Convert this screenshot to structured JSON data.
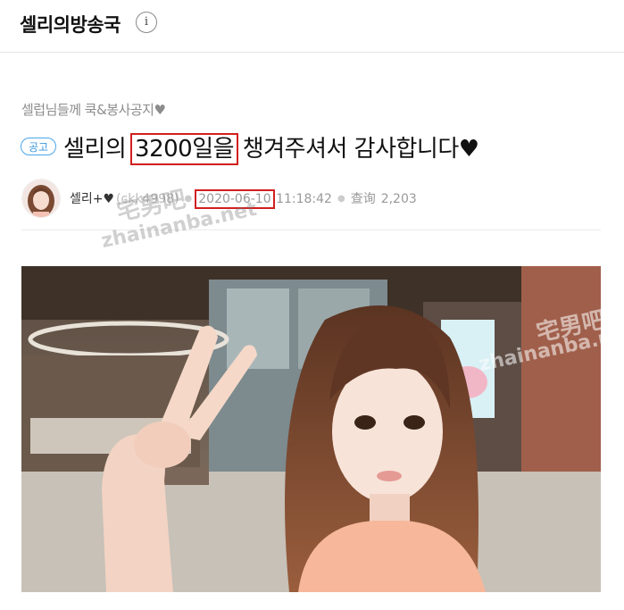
{
  "header": {
    "site_title": "셀리의방송국",
    "info_icon": "i"
  },
  "post": {
    "category": "셀럽님들께 쿡&봉사공지♥",
    "badge": "공고",
    "title_before": "셀리의 ",
    "title_highlight": "3200일을",
    "title_after": " 챙겨주셔서 감사합니다♥",
    "author": "셀리+♥",
    "user_id": "(ckk4998)",
    "date": "2020-06-10",
    "time": "11:18:42",
    "views_label": "查询",
    "views": "2,203"
  },
  "watermark": {
    "cn": "宅男吧",
    "url": "zhainanba.net"
  },
  "colors": {
    "highlight_box": "#d21f1f",
    "badge": "#3b97dd"
  }
}
